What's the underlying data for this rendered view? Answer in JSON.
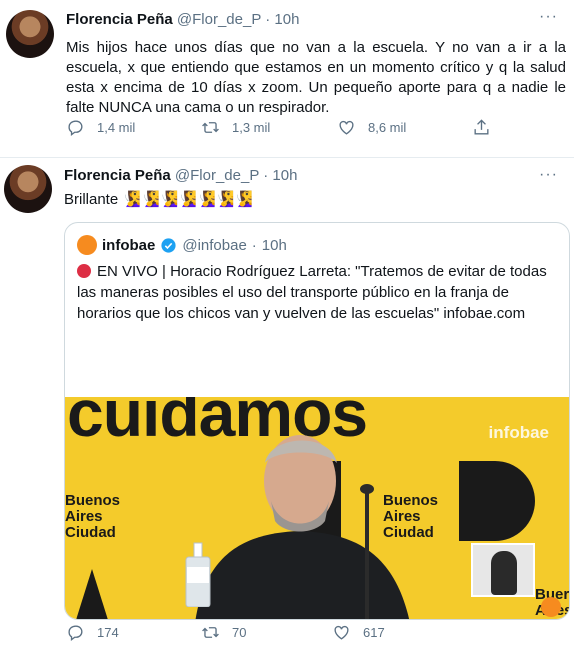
{
  "tweets": [
    {
      "name": "Florencia Peña",
      "handle": "@Flor_de_P",
      "separator": "·",
      "time": "10h",
      "text": "Mis hijos hace unos días que no van a la escuela. Y no van a ir a la escuela, x que entiendo que estamos en un momento crítico y q la salud esta x encima de 10 días  x zoom. Un pequeño aporte     para q a nadie le falte NUNCA una cama o un respirador.",
      "replies": "1,4 mil",
      "retweets": "1,3 mil",
      "likes": "8,6 mil"
    },
    {
      "name": "Florencia Peña",
      "handle": "@Flor_de_P",
      "separator": "·",
      "time": "10h",
      "text": "Brillante 🧏‍♀️🧏‍♀️🧏‍♀️🧏‍♀️🧏‍♀️🧏‍♀️🧏‍♀️",
      "replies": "174",
      "retweets": "70",
      "likes": "617",
      "quote": {
        "name": "infobae",
        "handle": "@infobae",
        "separator": "·",
        "time": "10h",
        "text": "EN VIVO | Horacio Rodríguez Larreta: \"Tratemos de evitar de todas las maneras posibles el uso del transporte público en la franja de horarios que los chicos van y vuelven de las escuelas\" infobae.com",
        "image": {
          "big_text": "cuidamos",
          "brand": "infobae",
          "left_logo": "Buenos Aires Ciudad",
          "mid_logo": "Buenos Aires Ciudad",
          "right_logo": "Buer Aires Ciud"
        }
      }
    }
  ],
  "colors": {
    "secondary_text": "#5b7083",
    "border": "#cfd9de",
    "brand_yellow": "#f4cb2b",
    "infobae_orange": "#f68b1f",
    "verified_blue": "#1da1f2",
    "live_red": "#dd2e44"
  },
  "icons": [
    "avatar",
    "more-icon",
    "reply-icon",
    "retweet-icon",
    "like-icon",
    "share-icon",
    "verified-icon",
    "live-dot-icon"
  ]
}
